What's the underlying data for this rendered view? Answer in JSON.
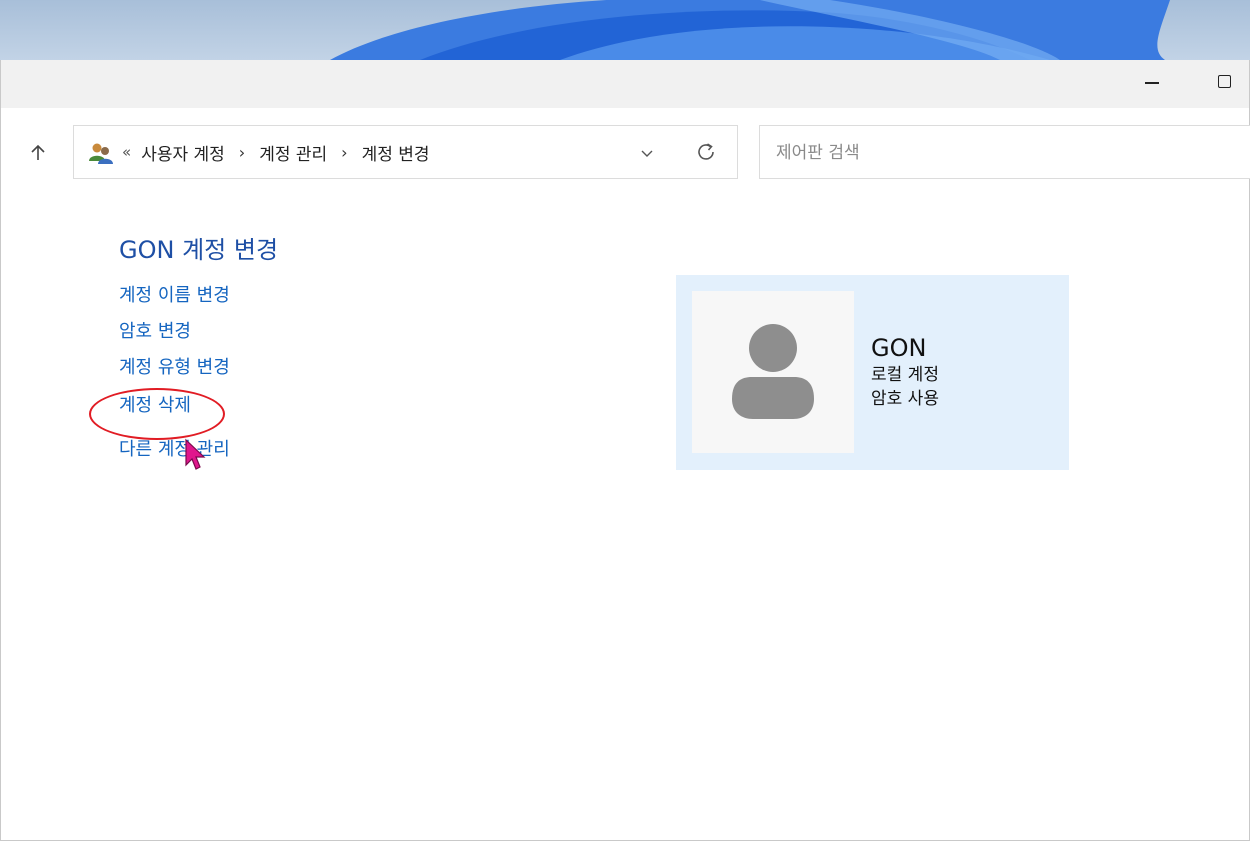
{
  "window": {
    "minimize_icon": "minimize-icon",
    "maximize_icon": "maximize-icon"
  },
  "nav": {
    "up_icon": "up-arrow-icon"
  },
  "address_bar": {
    "icon": "users-icon",
    "leading": "«",
    "breadcrumbs": [
      "사용자 계정",
      "계정 관리",
      "계정 변경"
    ],
    "separator": "›",
    "dropdown_icon": "chevron-down-icon",
    "refresh_icon": "refresh-icon"
  },
  "search": {
    "placeholder": "제어판 검색"
  },
  "main": {
    "title": "GON 계정 변경",
    "tasks": [
      "계정 이름 변경",
      "암호 변경",
      "계정 유형 변경",
      "계정 삭제",
      "다른 계정 관리"
    ]
  },
  "account": {
    "name": "GON",
    "type": "로컬 계정",
    "password_status": "암호 사용"
  },
  "colors": {
    "link": "#1565c0",
    "title": "#1e4fa5",
    "card_bg": "#e3f0fc",
    "highlight": "#e11c24",
    "cursor": "#e0168c"
  }
}
